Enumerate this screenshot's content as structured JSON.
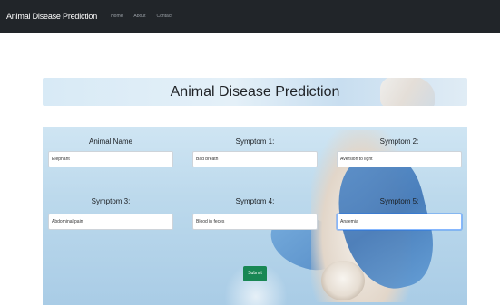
{
  "navbar": {
    "brand": "Animal Disease Prediction",
    "links": [
      "Home",
      "About",
      "Contact"
    ]
  },
  "page": {
    "title": "Animal Disease Prediction"
  },
  "form": {
    "fields": [
      {
        "label": "Animal Name",
        "value": "Elephant"
      },
      {
        "label": "Symptom 1:",
        "value": "Bad breath"
      },
      {
        "label": "Symptom 2:",
        "value": "Aversion to light"
      },
      {
        "label": "Symptom 3:",
        "value": "Abdominal pain"
      },
      {
        "label": "Symptom 4:",
        "value": "Blood in feces"
      },
      {
        "label": "Symptom 5:",
        "value": "Anaemia"
      }
    ],
    "submit_label": "Submit"
  },
  "colors": {
    "navbar_bg": "#212529",
    "submit_bg": "#198754"
  }
}
